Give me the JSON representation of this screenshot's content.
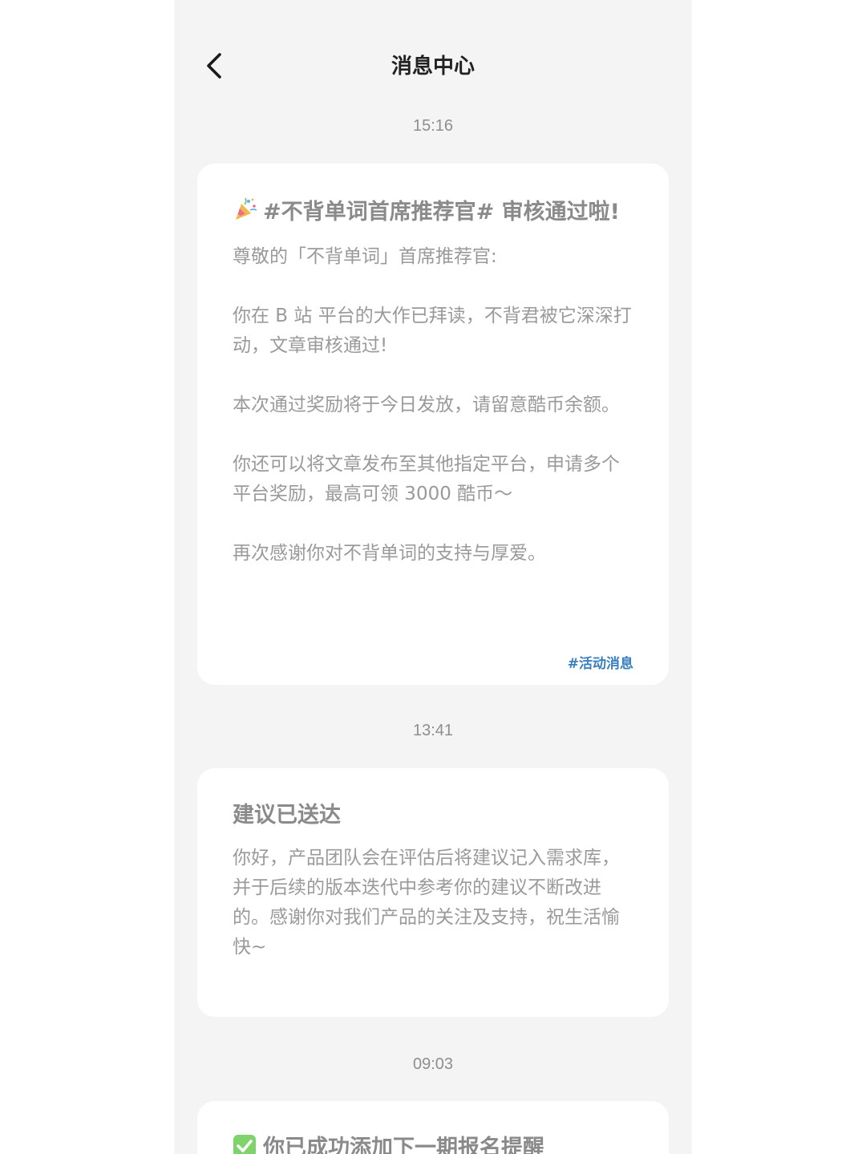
{
  "header": {
    "title": "消息中心"
  },
  "messages": [
    {
      "time": "15:16",
      "title": "#不背单词首席推荐官# 审核通过啦!",
      "title_icon": "party-popper-icon",
      "paragraphs": [
        "尊敬的「不背单词」首席推荐官:",
        "你在 B 站 平台的大作已拜读，不背君被它深深打动，文章审核通过!",
        "本次通过奖励将于今日发放，请留意酷币余额。",
        "你还可以将文章发布至其他指定平台，申请多个平台奖励，最高可领 3000 酷币～",
        "再次感谢你对不背单词的支持与厚爱。"
      ],
      "tag": "#活动消息"
    },
    {
      "time": "13:41",
      "title": "建议已送达",
      "paragraphs": [
        "你好，产品团队会在评估后将建议记入需求库，并于后续的版本迭代中参考你的建议不断改进的。感谢你对我们产品的关注及支持，祝生活愉快~"
      ]
    },
    {
      "time": "09:03",
      "title": "你已成功添加下一期报名提醒",
      "title_icon": "check-mark-icon"
    }
  ],
  "colors": {
    "background": "#f4f4f4",
    "card": "#ffffff",
    "tag": "#3a7fc2",
    "check_icon": "#7ed46a"
  }
}
